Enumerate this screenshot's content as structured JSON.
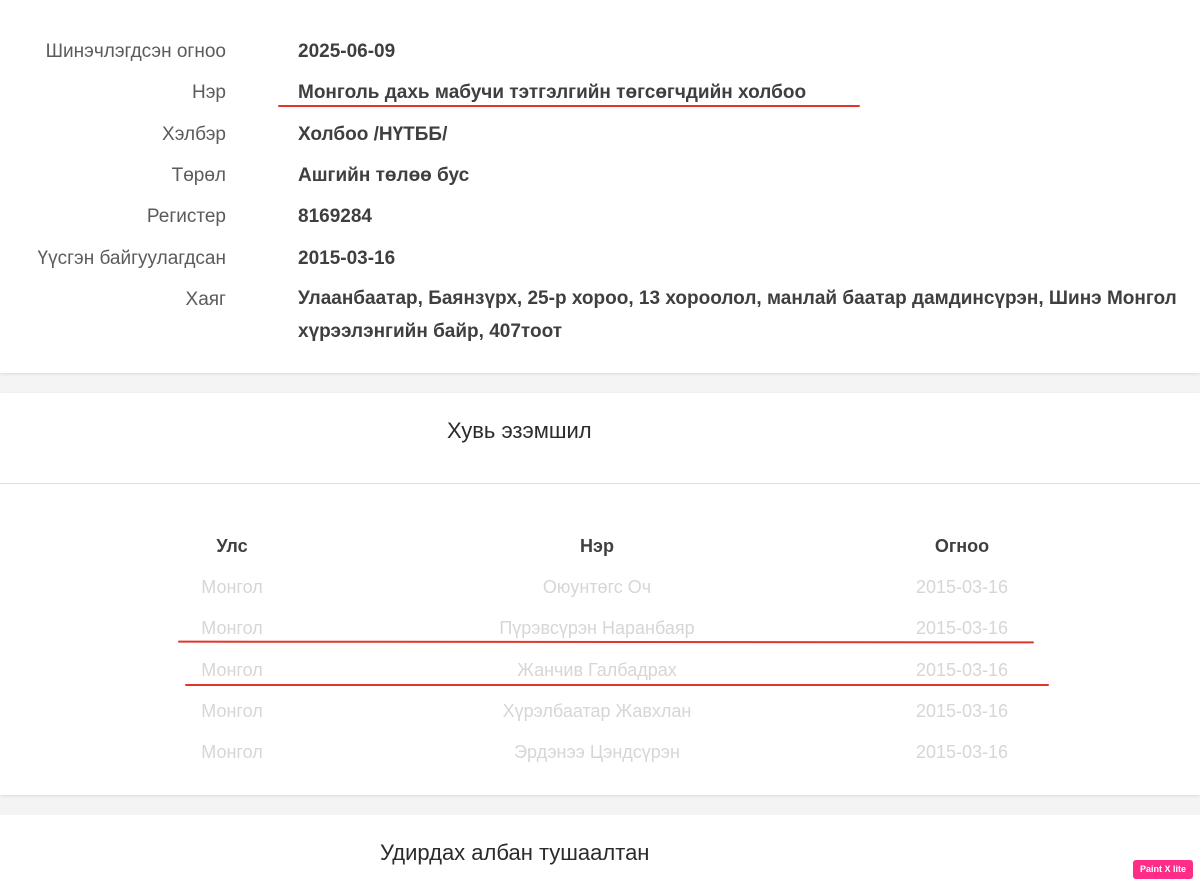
{
  "info": {
    "updated_label": "Шинэчлэгдсэн огноо",
    "updated_value": "2025-06-09",
    "name_label": "Нэр",
    "name_value": "Монголь дахь мабучи тэтгэлгийн төгсөгчдийн холбоо",
    "form_label": "Хэлбэр",
    "form_value": "Холбоо /НҮТББ/",
    "type_label": "Төрөл",
    "type_value": "Ашгийн төлөө бус",
    "register_label": "Регистер",
    "register_value": "8169284",
    "founded_label": "Үүсгэн байгуулагдсан",
    "founded_value": "2015-03-16",
    "address_label": "Хаяг",
    "address_value": "Улаанбаатар, Баянзүрх, 25-р хороо, 13 хороолол, манлай баатар дамдинсүрэн, Шинэ Монгол хүрээлэнгийн байр, 407тоот"
  },
  "ownership": {
    "title": "Хувь эзэмшил",
    "headers": {
      "country": "Улс",
      "name": "Нэр",
      "date": "Огноо"
    },
    "rows": [
      {
        "country": "Монгол",
        "name": "Оюунтөгс Оч",
        "date": "2015-03-16"
      },
      {
        "country": "Монгол",
        "name": "Пүрэвсүрэн Наранбаяр",
        "date": "2015-03-16"
      },
      {
        "country": "Монгол",
        "name": "Жанчив Галбадрах",
        "date": "2015-03-16"
      },
      {
        "country": "Монгол",
        "name": "Хүрэлбаатар Жавхлан",
        "date": "2015-03-16"
      },
      {
        "country": "Монгол",
        "name": "Эрдэнээ Цэндсүрэн",
        "date": "2015-03-16"
      }
    ]
  },
  "officials": {
    "title": "Удирдах албан тушаалтан"
  },
  "watermark": {
    "text": "Paint X lite"
  },
  "colors": {
    "annotation_red": "#e0362c",
    "badge_pink": "#ff2d88"
  }
}
